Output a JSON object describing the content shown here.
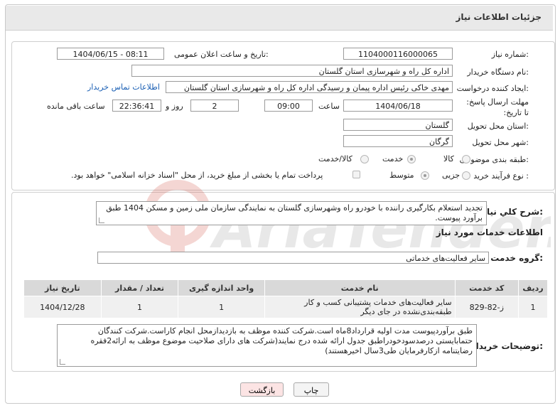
{
  "header": {
    "title": "جزئیات اطلاعات نیاز"
  },
  "labels": {
    "need_number": "شماره نیاز:",
    "announce_datetime": "تاریخ و ساعت اعلان عمومی:",
    "buyer_org": "نام دستگاه خریدار:",
    "requester": "ایجاد کننده درخواست:",
    "deadline": "مهلت ارسال پاسخ: تا تاریخ:",
    "time_word": "ساعت",
    "day_and": "روز و",
    "remaining": "ساعت باقی مانده",
    "delivery_province": "استان محل تحویل:",
    "delivery_city": "شهر محل تحویل:",
    "category": "طبقه بندی موضوعی:",
    "purchase_type": "نوع فرآیند خرید :",
    "general_desc": "شرح کلي نياز:",
    "services_info": "اطلاعات خدمات مورد نیاز",
    "service_group": "گروه خدمت:",
    "buyer_notes": "توضیحات خریدار:"
  },
  "fields": {
    "need_number": "1104000116000065",
    "announce_datetime": "1404/06/15 - 08:11",
    "buyer_org": "اداره کل راه و شهرسازی استان گلستان",
    "requester": "مهدی خاکی رئیس اداره پیمان و رسیدگی اداره کل راه و شهرسازی استان گلستان",
    "contact_link": "اطلاعات تماس خریدار",
    "deadline_date": "1404/06/18",
    "deadline_time": "09:00",
    "days": "2",
    "remaining_time": "22:36:41",
    "delivery_province": "گلستان",
    "delivery_city": "گرگان"
  },
  "category_options": [
    {
      "label": "کالا",
      "checked": false
    },
    {
      "label": "خدمت",
      "checked": true
    },
    {
      "label": "کالا/خدمت",
      "checked": false
    }
  ],
  "purchase_options": [
    {
      "label": "جزیی",
      "checked": false
    },
    {
      "label": "متوسط",
      "checked": true
    }
  ],
  "payment_note": "پرداخت تمام یا بخشی از مبلغ خرید، از محل \"اسناد خزانه اسلامی\" خواهد بود.",
  "general_desc": "تجدید استعلام بکارگیری راننده با خودرو راه وشهرسازی گلستان به نمایندگی سازمان ملی زمین و مسکن 1404 طبق برآورد پیوست.",
  "service_group": "سایر فعالیت‌های خدماتی",
  "table": {
    "headers": [
      "ردیف",
      "کد خدمت",
      "نام خدمت",
      "واحد اندازه گیری",
      "تعداد / مقدار",
      "تاریخ نیاز"
    ],
    "rows": [
      [
        "1",
        "ز-82-829",
        "سایر فعالیت‌های خدمات پشتیبانی کسب و کار طبقه‌بندی‌نشده در جای دیگر",
        "1",
        "1",
        "1404/12/28"
      ]
    ]
  },
  "buyer_notes": "طبق برآوردپیوست مدت اولیه قرارداد8ماه است.شرکت کننده موظف به بازدیدازمحل انجام کاراست.شرکت کنندگان حتمابایستی درصدسودخودراطبق جدول ارائه شده درج نمایند(شرکت های دارای صلاحیت موضوع موظف به ارائه2فقره رضایتنامه ازکارفرمایان طی3سال اخیرهستند)",
  "buttons": {
    "print": "چاپ",
    "back": "بازگشت"
  },
  "colors": {
    "link": "#1a5fb4",
    "back_button": "#fce4e4",
    "header_bg": "#e9e9e9"
  },
  "watermark": {
    "text": "AriaTender.neT"
  }
}
